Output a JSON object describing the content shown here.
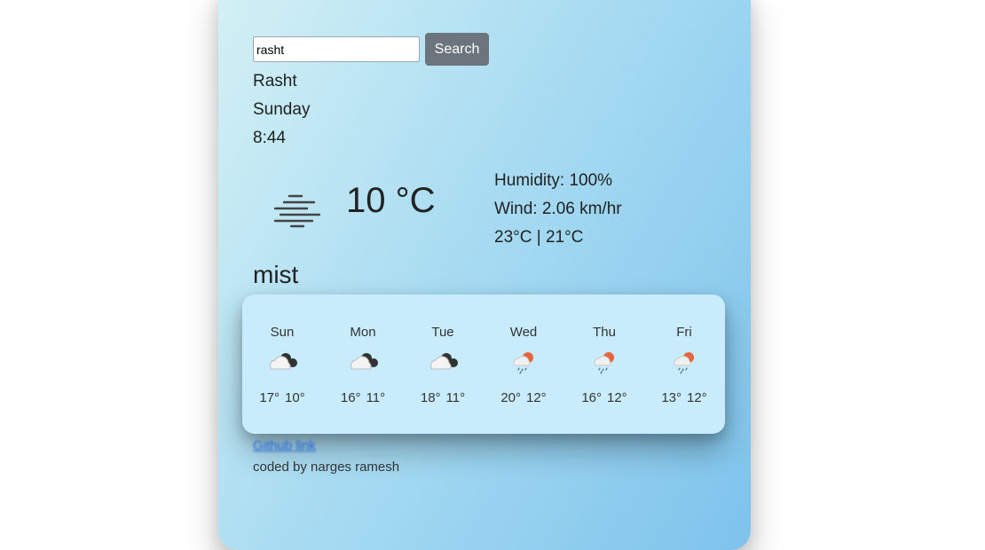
{
  "search": {
    "value": "rasht",
    "button_label": "Search"
  },
  "location": {
    "city": "Rasht",
    "day": "Sunday",
    "time": "8:44"
  },
  "current": {
    "icon": "mist-icon",
    "temperature": "10 °C",
    "description": "mist",
    "humidity": "Humidity: 100%",
    "wind": "Wind: 2.06 km/hr",
    "high_low": "23°C | 21°C"
  },
  "forecast": [
    {
      "day": "Sun",
      "icon": "cloud-icon",
      "max": "17°",
      "min": "10°"
    },
    {
      "day": "Mon",
      "icon": "cloud-icon",
      "max": "16°",
      "min": "11°"
    },
    {
      "day": "Tue",
      "icon": "cloud-icon",
      "max": "18°",
      "min": "11°"
    },
    {
      "day": "Wed",
      "icon": "rain-sun-icon",
      "max": "20°",
      "min": "12°"
    },
    {
      "day": "Thu",
      "icon": "rain-sun-icon",
      "max": "16°",
      "min": "12°"
    },
    {
      "day": "Fri",
      "icon": "rain-sun-icon",
      "max": "13°",
      "min": "12°"
    }
  ],
  "footer": {
    "link_label": "Github link",
    "credit": "coded by narges ramesh"
  },
  "colors": {
    "button": "#6c757d",
    "forecast_panel": "#c9ecfc",
    "link": "#1e5fd6"
  }
}
